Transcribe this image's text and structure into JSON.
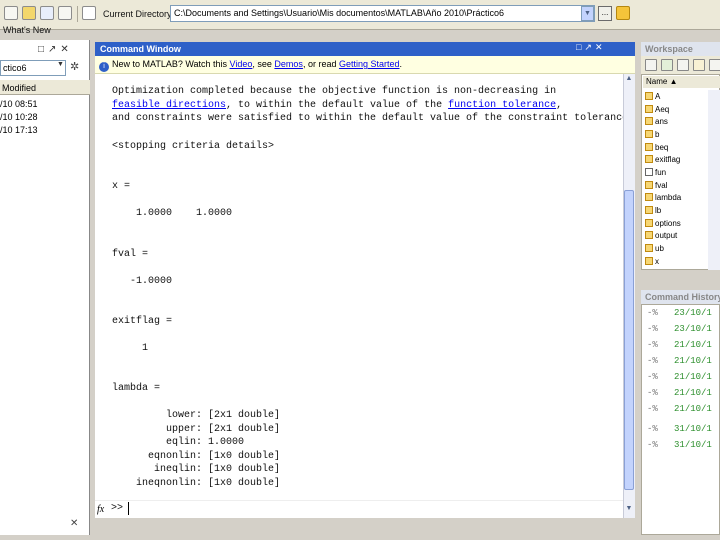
{
  "toolbar": {
    "current_dir_label": "Current Directory:",
    "current_dir_value": "C:\\Documents and Settings\\Usuario\\Mis documentos\\MATLAB\\Año 2010\\Práctico6",
    "browse_label": "..."
  },
  "left_panel": {
    "title": "What's New",
    "path_value": "ctico6",
    "column_modified": "Modified",
    "dates": [
      "/10 08:51",
      "/10 10:28",
      "/10 17:13"
    ]
  },
  "command_window": {
    "title": "Command Window",
    "info": {
      "pre": "New to MATLAB? Watch this ",
      "video_link": "Video",
      "mid1": ", see ",
      "demos_link": "Demos",
      "mid2": ", or read ",
      "getting_started_link": "Getting Started",
      "post": "."
    },
    "output": {
      "line1": "Optimization completed because the objective function is non-decreasing in",
      "line2_link1": "feasible directions",
      "line2_mid": ", to within the default value of the ",
      "line2_link2": "function tolerance",
      "line2_end": ",",
      "line3": "and constraints were satisfied to within the default value of the constraint tolerance.",
      "stopping": "<stopping criteria details>",
      "x_label": "x =",
      "x_value": "    1.0000    1.0000",
      "fval_label": "fval =",
      "fval_value": "   -1.0000",
      "exitflag_label": "exitflag =",
      "exitflag_value": "     1",
      "lambda_label": "lambda =",
      "lambda_fields": [
        "         lower: [2x1 double]",
        "         upper: [2x1 double]",
        "         eqlin: 1.0000",
        "      eqnonlin: [1x0 double]",
        "       ineqlin: [1x0 double]",
        "    ineqnonlin: [1x0 double]"
      ]
    },
    "prompt": ">>"
  },
  "workspace": {
    "title": "Workspace",
    "column_name": "Name ▲",
    "variables": [
      "A",
      "Aeq",
      "ans",
      "b",
      "beq",
      "exitflag",
      "fun",
      "fval",
      "lambda",
      "lb",
      "options",
      "output",
      "ub",
      "x"
    ]
  },
  "command_history": {
    "title": "Command History",
    "entries": [
      "23/10/1",
      "23/10/1",
      "21/10/1",
      "21/10/1",
      "21/10/1",
      "21/10/1",
      "21/10/1",
      "31/10/1",
      "31/10/1"
    ]
  }
}
